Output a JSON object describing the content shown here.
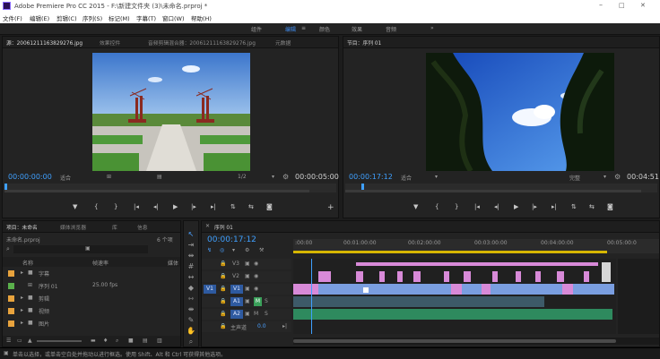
{
  "window": {
    "title": "Adobe Premiere Pro CC 2015 - F:\\新建文件夹 (3)\\未命名.prproj *",
    "min": "–",
    "max": "□",
    "close": "✕"
  },
  "menu": [
    "文件(F)",
    "编辑(E)",
    "剪辑(C)",
    "序列(S)",
    "标记(M)",
    "字幕(T)",
    "窗口(W)",
    "帮助(H)"
  ],
  "workspaces": {
    "items": [
      "组件",
      "编辑",
      "颜色",
      "效果",
      "音频"
    ],
    "active_marker": "≡",
    "more": "»"
  },
  "source": {
    "tabs": [
      "源：20061211163829276.jpg",
      "效果控件",
      "音频剪辑混合器：20061211163829276.jpg",
      "元数据"
    ],
    "timecode": "00:00:00:00",
    "fit": "适合",
    "ratio": "1/2",
    "duration": "00:00:05:00",
    "wrench": "🔧"
  },
  "program": {
    "tabs": [
      "节目：序列 01"
    ],
    "timecode": "00:00:17:12",
    "fit": "适合",
    "ratio": "完整",
    "duration": "00:04:51"
  },
  "transport": [
    "▼",
    "{",
    "}",
    "|◂",
    "◂|",
    "▶",
    "|▸",
    "▸|",
    "⇅",
    "⇆",
    "📷"
  ],
  "project": {
    "tabs": [
      "项目：未命名",
      "媒体浏览器",
      "库",
      "信息"
    ],
    "file": "未命名.prproj",
    "count": "6 个项",
    "search_placeholder": "",
    "col_name": "名称",
    "col_fps": "帧速率",
    "col_media": "媒体",
    "items": [
      {
        "name": "字幕",
        "fps": "",
        "color": "#e8a33d",
        "kind": "folder"
      },
      {
        "name": "序列 01",
        "fps": "25.00 fps",
        "color": "#5ab04b",
        "kind": "seq"
      },
      {
        "name": "剪辑",
        "fps": "",
        "color": "#e8a33d",
        "kind": "folder"
      },
      {
        "name": "视频",
        "fps": "",
        "color": "#e8a33d",
        "kind": "folder"
      },
      {
        "name": "图片",
        "fps": "",
        "color": "#e8a33d",
        "kind": "folder"
      }
    ]
  },
  "timeline": {
    "tab": "序列 01",
    "timecode": "00:00:17:12",
    "ruler": [
      ":00:00",
      "00:01:00:00",
      "00:02:00:00",
      "00:03:00:00",
      "00:04:00:00",
      "00:05:00:0"
    ],
    "tracks": [
      {
        "id": "V3",
        "src": ""
      },
      {
        "id": "V2",
        "src": ""
      },
      {
        "id": "V1",
        "src": "V1"
      },
      {
        "id": "A1",
        "src": "",
        "m": "M",
        "s": "S"
      },
      {
        "id": "A2",
        "src": "",
        "m": "M",
        "s": "S"
      },
      {
        "id": "主声道",
        "src": "",
        "vol": "0.0"
      }
    ]
  },
  "status": "单击以选择，或单击空白处并拖动以进行框选。使用 Shift、Alt 和 Ctrl 可获得其他选项。",
  "colors": {
    "accent": "#3f8cf0",
    "clip_pink": "#d88ad8",
    "clip_blue": "#7a9ee0",
    "clip_green": "#2e8a5e",
    "playhead": "#3fa0ff"
  }
}
